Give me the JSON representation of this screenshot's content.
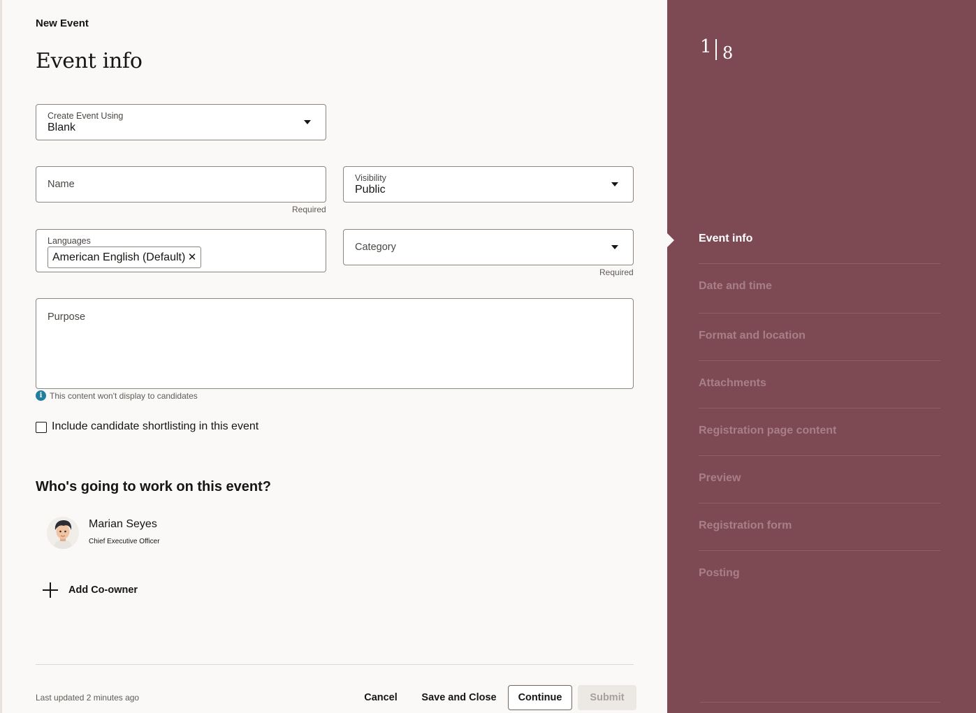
{
  "header": {
    "breadcrumb": "New Event",
    "title": "Event info"
  },
  "form": {
    "create_using": {
      "label": "Create Event Using",
      "value": "Blank"
    },
    "name": {
      "placeholder": "Name",
      "help": "Required"
    },
    "visibility": {
      "label": "Visibility",
      "value": "Public"
    },
    "languages": {
      "label": "Languages",
      "chips": [
        "American English (Default)"
      ]
    },
    "category": {
      "placeholder": "Category",
      "help": "Required"
    },
    "purpose": {
      "placeholder": "Purpose",
      "info": "This content won't display to candidates"
    },
    "shortlisting": {
      "label": "Include candidate shortlisting in this event",
      "checked": false
    }
  },
  "team": {
    "title": "Who's going to work on this event?",
    "owner": {
      "name": "Marian Seyes",
      "role": "Chief Executive Officer"
    },
    "add_label": "Add Co-owner"
  },
  "footer": {
    "last_updated": "Last updated 2 minutes ago",
    "cancel": "Cancel",
    "save_close": "Save and Close",
    "continue": "Continue",
    "submit": "Submit"
  },
  "steps": {
    "current": "1",
    "total": "8",
    "items": [
      {
        "label": "Event info",
        "active": true
      },
      {
        "label": "Date and time",
        "active": false
      },
      {
        "label": "Format and location",
        "active": false
      },
      {
        "label": "Attachments",
        "active": false
      },
      {
        "label": "Registration page content",
        "active": false
      },
      {
        "label": "Preview",
        "active": false
      },
      {
        "label": "Registration form",
        "active": false
      },
      {
        "label": "Posting",
        "active": false
      }
    ]
  },
  "colors": {
    "side_panel": "#7d4a53",
    "page_background": "#fbf9f8",
    "info_icon": "#227e9e"
  },
  "icons": [
    "chevron-down-icon",
    "close-icon",
    "info-icon",
    "plus-icon",
    "avatar"
  ]
}
